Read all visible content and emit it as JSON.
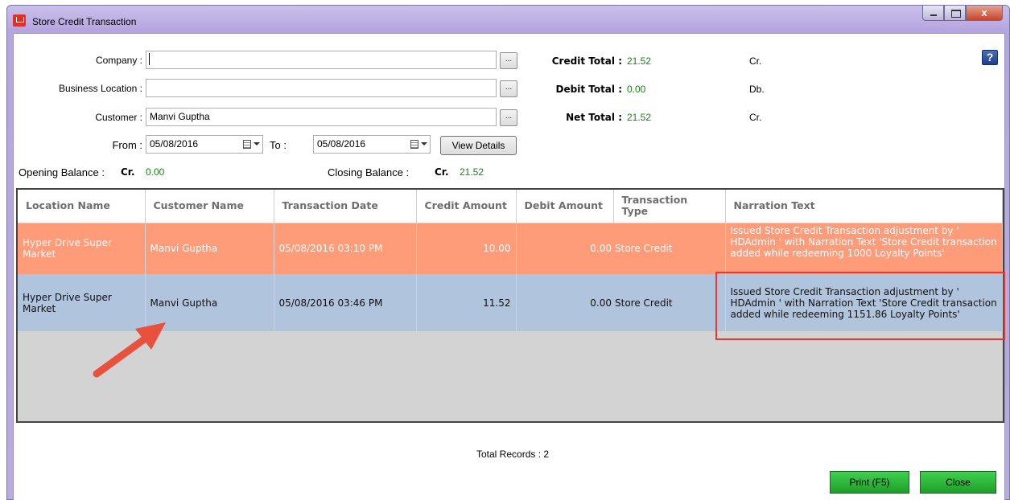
{
  "window": {
    "title": "Store Credit Transaction"
  },
  "form": {
    "company_label": "Company :",
    "company_value": "",
    "business_location_label": "Business Location :",
    "business_location_value": "",
    "customer_label": "Customer :",
    "customer_value": "Manvi Guptha",
    "ellipsis": "...",
    "from_label": "From :",
    "from_value": "05/08/2016",
    "to_label": "To :",
    "to_value": "05/08/2016",
    "view_details": "View Details",
    "opening_label": "Opening Balance :",
    "opening_prefix": "Cr.",
    "opening_value": "0.00",
    "closing_label": "Closing Balance :",
    "closing_prefix": "Cr.",
    "closing_value": "21.52"
  },
  "totals": {
    "credit_label": "Credit Total :",
    "credit_value": "21.52",
    "credit_suffix": "Cr.",
    "debit_label": "Debit Total :",
    "debit_value": "0.00",
    "debit_suffix": "Db.",
    "net_label": "Net Total :",
    "net_value": "21.52",
    "net_suffix": "Cr."
  },
  "help": "?",
  "grid": {
    "headers": [
      "Location Name",
      "Customer Name",
      "Transaction Date",
      "Credit Amount",
      "Debit Amount",
      "Transaction Type",
      "Narration Text"
    ],
    "rows": [
      {
        "location": "Hyper Drive Super Market",
        "customer": "Manvi Guptha",
        "date": "05/08/2016 03:10 PM",
        "credit": "10.00",
        "debit": "0.00",
        "type": "Store Credit",
        "narration": "Issued Store Credit Transaction adjustment by ' HDAdmin ' with Narration Text 'Store Credit transaction added while redeeming 1000 Loyalty Points'"
      },
      {
        "location": "Hyper Drive Super Market",
        "customer": "Manvi Guptha",
        "date": "05/08/2016 03:46 PM",
        "credit": "11.52",
        "debit": "0.00",
        "type": "Store Credit",
        "narration": "Issued Store Credit Transaction adjustment by ' HDAdmin ' with Narration Text 'Store Credit transaction added while redeeming 1151.86 Loyalty Points'"
      }
    ]
  },
  "footer": {
    "total_records": "Total Records : 2",
    "print": "Print (F5)",
    "close": "Close"
  },
  "colors": {
    "row_selected": "#fe9b79",
    "row_hover": "#b0c4de",
    "value_green": "#1a7f1a",
    "highlight_red": "#e03a3a",
    "button_green": "#2bb536"
  }
}
